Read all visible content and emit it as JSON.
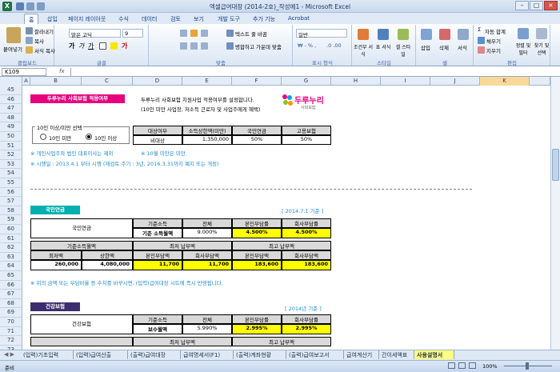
{
  "title": "엑셀급여대장 (2014-2호)_작성예1 - Microsoft Excel",
  "app_icon": "excel-icon",
  "tabs": [
    "홈",
    "삽입",
    "페이지 레이아웃",
    "수식",
    "데이터",
    "검토",
    "보기",
    "개발 도구",
    "추가 기능",
    "Acrobat"
  ],
  "ribbon": {
    "clipboard": {
      "paste": "붙여넣기",
      "cut": "잘라내기",
      "copy": "복사",
      "format_painter": "서식 복사",
      "label": "클립보드"
    },
    "font": {
      "name": "맑은 고딕",
      "size": "9",
      "label": "글꼴"
    },
    "align": {
      "wrap": "텍스트 줄 바꿈",
      "merge": "병합하고 가운데 맞춤",
      "label": "맞춤"
    },
    "number": {
      "format": "일반",
      "label": "표시 형식"
    },
    "styles": {
      "cond": "조건부 서식",
      "table": "표 서식",
      "cell": "셀 스타일",
      "label": "스타일"
    },
    "cells": {
      "insert": "삽입",
      "delete": "삭제",
      "format": "서식",
      "label": "셀"
    },
    "editing": {
      "autosum": "자동 합계",
      "fill": "채우기",
      "clear": "지우기",
      "sort": "정렬 및 필터",
      "find": "찾기 및 선택",
      "label": "편집"
    }
  },
  "namebox": "K109",
  "fx": "fx",
  "columns": [
    "A",
    "B",
    "C",
    "D",
    "E",
    "F",
    "G",
    "H",
    "I",
    "J",
    "K"
  ],
  "rows": [
    "45",
    "46",
    "47",
    "48",
    "49",
    "50",
    "51",
    "52",
    "53",
    "54",
    "55",
    "56",
    "57",
    "58",
    "59",
    "60",
    "61",
    "62",
    "63",
    "64",
    "65",
    "66",
    "67",
    "68",
    "69",
    "70",
    "71",
    "72",
    "73"
  ],
  "sheet": {
    "section1_title": "두루누리 사회보험 적용여부",
    "notice1": "두루누리 사회보험 지원사업 적용여부를 설정합니다.",
    "notice2": "(10인 미만 사업장, 저소득 근로자 및 사업주에게 혜택)",
    "logo_text": "두루누리",
    "logo_sub": "사회보험",
    "option_group": "10인 이상/미만 선택",
    "option_under": "10인 미만",
    "option_over": "10인 이상",
    "status_table": {
      "headers": [
        "대상여부",
        "소득상한액(미만)",
        "국민연금",
        "고용보험"
      ],
      "values": [
        "비대상",
        "1,350,000",
        "50%",
        "50%"
      ]
    },
    "note1": "※ 개인사업주와 법인 대표이사는 제외",
    "note1b": "※ 10월 미만은 미만.",
    "note2": "※ 시행일 : 2013.4.1 부터 시행 (재검토 주기 : 3년, 2016.3.31까지 폐지 또는 개정)",
    "pension_title": "국민연금",
    "pension_basis": "[ 2014.7.1 기준 ]",
    "pension": {
      "hdr": [
        "기준소득",
        "전체",
        "본인부담률",
        "회사부담률"
      ],
      "label": "국민연금",
      "basis_label": "기준 소득월액",
      "total": "9.000%",
      "self_rate": "4.500%",
      "company_rate": "4.500%",
      "income_hdr": "기준소득월액",
      "min_hdr": "최저 납부액",
      "max_hdr": "최고 납부액",
      "sub_hdr": [
        "최저액",
        "상한액",
        "본인부담액",
        "회사부담액",
        "본인부담액",
        "회사부담액"
      ],
      "sub_vals": [
        "260,000",
        "4,080,000",
        "11,700",
        "11,700",
        "183,600",
        "183,600"
      ]
    },
    "note3": "※ 위의 금액 또는 부담비율 등 수치를 바꾸시면, (입력)급여대장 시트에 즉시 반영됩니다.",
    "health_title": "건강보험",
    "health_basis": "[ 2014년 기준 ]",
    "health": {
      "hdr": [
        "기준소득",
        "전체",
        "본인부담률",
        "회사부담률"
      ],
      "label": "건강보험",
      "basis_label": "보수월액",
      "total": "5.990%",
      "self_rate": "2.995%",
      "company_rate": "2.995%",
      "min_hdr": "최저 납부액",
      "max_hdr": "최고 납부액"
    }
  },
  "sheet_tabs": [
    "(입력)기초입력",
    "(입력)급여산출",
    "(출력)급여대장",
    "급여명세서(F1)",
    "(출력)계좌현황",
    "(출력)급여보고서",
    "급여계산기",
    "간이세액표",
    "사용설명서"
  ],
  "status": {
    "left": "준비",
    "zoom": "100%"
  }
}
